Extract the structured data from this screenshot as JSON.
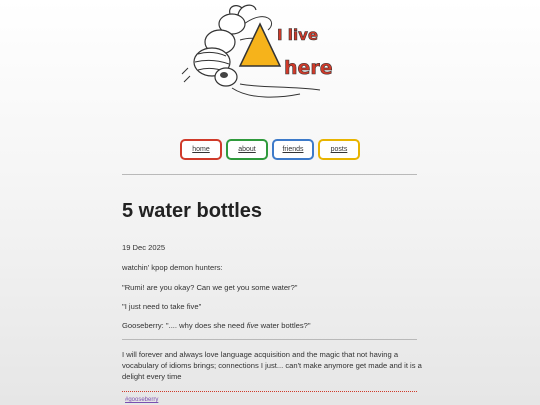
{
  "logo": {
    "line1": "I live",
    "line2": "here"
  },
  "nav": [
    {
      "label": "home",
      "color": "#d03a2a"
    },
    {
      "label": "about",
      "color": "#2f9a3c"
    },
    {
      "label": "friends",
      "color": "#3d7ac9"
    },
    {
      "label": "posts",
      "color": "#e8b400"
    }
  ],
  "post": {
    "title": "5 water bottles",
    "date": "19 Dec 2025",
    "lines": {
      "l1": "watchin' kpop demon hunters:",
      "l2": "\"Rumi! are you okay? Can we get you some water?\"",
      "l3": "\"I just need to take five\"",
      "l4_pre": "Gooseberry: \".... why does she need ",
      "l4_em": "five",
      "l4_post": " water bottles?\""
    },
    "paragraph": "I will forever and always love language acquisition and the magic that not having a vocabulary of idioms brings; connections I just... can't make anymore get made and it is a delight every time",
    "tag": "#gooseberry"
  }
}
